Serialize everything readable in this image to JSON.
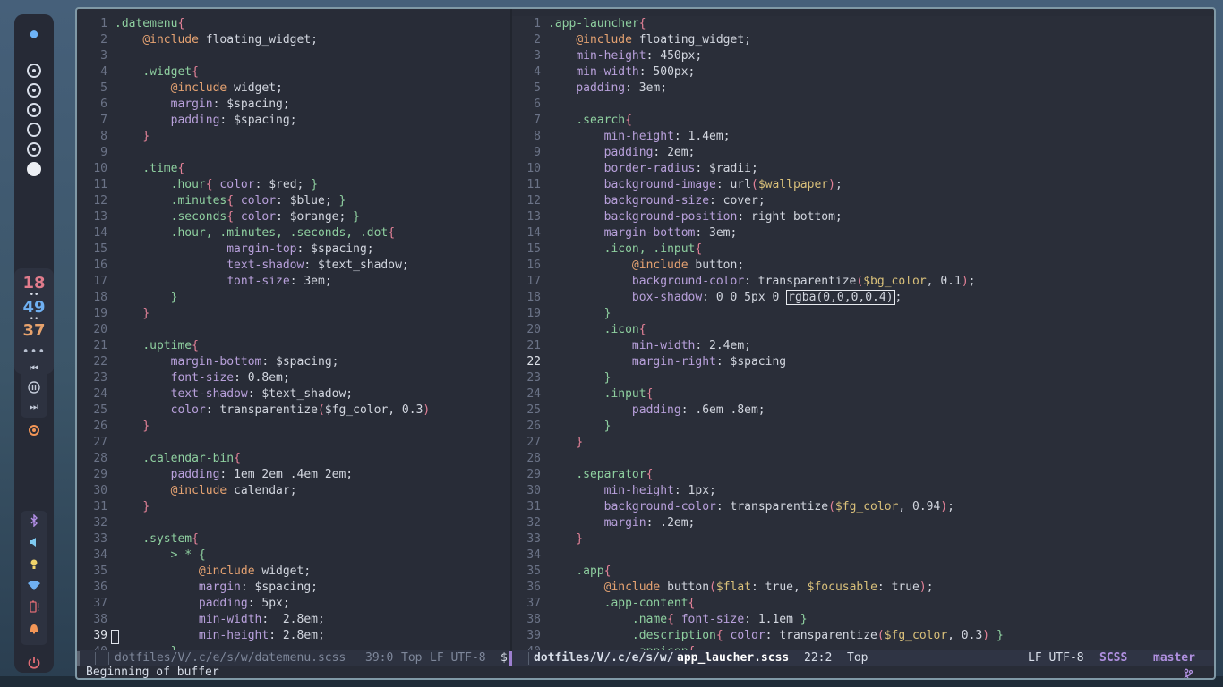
{
  "bar": {
    "logo_icon": "alien-icon",
    "workspaces": [
      "occupied",
      "occupied",
      "occupied",
      "empty",
      "occupied",
      "focused"
    ],
    "clock": {
      "hours": "18",
      "minutes": "49",
      "seconds": "37"
    },
    "media": {
      "prev_icon": "skip-previous-icon",
      "play_icon": "pause-icon",
      "next_icon": "skip-next-icon"
    },
    "system": [
      "bluetooth-icon",
      "volume-icon",
      "brightness-icon",
      "wifi-icon",
      "battery-icon",
      "notification-bell-icon"
    ],
    "power_icon": "power-icon"
  },
  "left_buffer": {
    "current_line": 39,
    "lines": [
      {
        "n": 1,
        "html": "<span class='sel'>.datemenu</span><span class='br'>{</span>"
      },
      {
        "n": 2,
        "html": "    <span class='inc'>@include</span> floating_widget;"
      },
      {
        "n": 3,
        "html": ""
      },
      {
        "n": 4,
        "html": "    <span class='sel'>.widget</span><span class='br'>{</span>"
      },
      {
        "n": 5,
        "html": "        <span class='inc'>@include</span> widget;"
      },
      {
        "n": 6,
        "html": "        <span class='prop'>margin</span>: $spacing;"
      },
      {
        "n": 7,
        "html": "        <span class='prop'>padding</span>: $spacing;"
      },
      {
        "n": 8,
        "html": "    <span class='br'>}</span>"
      },
      {
        "n": 9,
        "html": ""
      },
      {
        "n": 10,
        "html": "    <span class='sel'>.time</span><span class='br'>{</span>"
      },
      {
        "n": 11,
        "html": "        <span class='sel'>.hour</span><span class='br'>{</span> <span class='prop'>color</span>: $red; <span class='sel'>}</span>"
      },
      {
        "n": 12,
        "html": "        <span class='sel'>.minutes</span><span class='br'>{</span> <span class='prop'>color</span>: $blue; <span class='sel'>}</span>"
      },
      {
        "n": 13,
        "html": "        <span class='sel'>.seconds</span><span class='br'>{</span> <span class='prop'>color</span>: $orange; <span class='sel'>}</span>"
      },
      {
        "n": 14,
        "html": "        <span class='sel'>.hour, .minutes, .seconds, .dot</span><span class='br'>{</span>"
      },
      {
        "n": 15,
        "html": "                <span class='prop'>margin-top</span>: $spacing;"
      },
      {
        "n": 16,
        "html": "                <span class='prop'>text-shadow</span>: $text_shadow;"
      },
      {
        "n": 17,
        "html": "                <span class='prop'>font-size</span>: 3em;"
      },
      {
        "n": 18,
        "html": "        <span class='sel'>}</span>"
      },
      {
        "n": 19,
        "html": "    <span class='br'>}</span>"
      },
      {
        "n": 20,
        "html": ""
      },
      {
        "n": 21,
        "html": "    <span class='sel'>.uptime</span><span class='br'>{</span>"
      },
      {
        "n": 22,
        "html": "        <span class='prop'>margin-bottom</span>: $spacing;"
      },
      {
        "n": 23,
        "html": "        <span class='prop'>font-size</span>: 0.8em;"
      },
      {
        "n": 24,
        "html": "        <span class='prop'>text-shadow</span>: $text_shadow;"
      },
      {
        "n": 25,
        "html": "        <span class='prop'>color</span>: transparentize<span class='br'>(</span>$fg_color, 0.3<span class='br'>)</span>"
      },
      {
        "n": 26,
        "html": "    <span class='br'>}</span>"
      },
      {
        "n": 27,
        "html": ""
      },
      {
        "n": 28,
        "html": "    <span class='sel'>.calendar-bin</span><span class='br'>{</span>"
      },
      {
        "n": 29,
        "html": "        <span class='prop'>padding</span>: 1em 2em .4em 2em;"
      },
      {
        "n": 30,
        "html": "        <span class='inc'>@include</span> calendar;"
      },
      {
        "n": 31,
        "html": "    <span class='br'>}</span>"
      },
      {
        "n": 32,
        "html": ""
      },
      {
        "n": 33,
        "html": "    <span class='sel'>.system</span><span class='br'>{</span>"
      },
      {
        "n": 34,
        "html": "        <span class='sel'>&gt; * {</span>"
      },
      {
        "n": 35,
        "html": "            <span class='inc'>@include</span> widget;"
      },
      {
        "n": 36,
        "html": "            <span class='prop'>margin</span>: $spacing;"
      },
      {
        "n": 37,
        "html": "            <span class='prop'>padding</span>: 5px;"
      },
      {
        "n": 38,
        "html": "            <span class='prop'>min-width</span>:  2.8em;"
      },
      {
        "n": 39,
        "html": "            <span class='prop'>min-height</span>: 2.8em;"
      },
      {
        "n": 40,
        "html": "        <span class='sel'>}</span>"
      }
    ]
  },
  "right_buffer": {
    "current_line": 22,
    "lines": [
      {
        "n": 1,
        "html": "<span class='sel'>.app-launcher</span><span class='br'>{</span>"
      },
      {
        "n": 2,
        "html": "    <span class='inc'>@include</span> floating_widget;"
      },
      {
        "n": 3,
        "html": "    <span class='prop'>min-height</span>: 450px;"
      },
      {
        "n": 4,
        "html": "    <span class='prop'>min-width</span>: 500px;"
      },
      {
        "n": 5,
        "html": "    <span class='prop'>padding</span>: 3em;"
      },
      {
        "n": 6,
        "html": ""
      },
      {
        "n": 7,
        "html": "    <span class='sel'>.search</span><span class='br'>{</span>"
      },
      {
        "n": 8,
        "html": "        <span class='prop'>min-height</span>: 1.4em;"
      },
      {
        "n": 9,
        "html": "        <span class='prop'>padding</span>: 2em;"
      },
      {
        "n": 10,
        "html": "        <span class='prop'>border-radius</span>: $radii;"
      },
      {
        "n": 11,
        "html": "        <span class='prop'>background-image</span>: url<span class='br'>(</span><span class='var'>$wallpaper</span><span class='br'>)</span>;"
      },
      {
        "n": 12,
        "html": "        <span class='prop'>background-size</span>: cover;"
      },
      {
        "n": 13,
        "html": "        <span class='prop'>background-position</span>: right bottom;"
      },
      {
        "n": 14,
        "html": "        <span class='prop'>margin-bottom</span>: 3em;"
      },
      {
        "n": 15,
        "html": "        <span class='sel'>.icon, .input</span><span class='br'>{</span>"
      },
      {
        "n": 16,
        "html": "            <span class='inc'>@include</span> button;"
      },
      {
        "n": 17,
        "html": "            <span class='prop'>background-color</span>: transparentize<span class='br'>(</span><span class='var'>$bg_color</span>, 0.1<span class='br'>)</span>;"
      },
      {
        "n": 18,
        "html": "            <span class='prop'>box-shadow</span>: 0 0 5px 0 <span class='hl'>rgba(0,0,0,0.4)</span>;"
      },
      {
        "n": 19,
        "html": "        <span class='sel'>}</span>"
      },
      {
        "n": 20,
        "html": "        <span class='sel'>.icon</span><span class='br'>{</span>"
      },
      {
        "n": 21,
        "html": "            <span class='prop'>min-width</span>: 2.4em;"
      },
      {
        "n": 22,
        "html": "            <span class='prop'>margin-right</span>: $spacing"
      },
      {
        "n": 23,
        "html": "        <span class='sel'>}</span>"
      },
      {
        "n": 24,
        "html": "        <span class='sel'>.input</span><span class='br'>{</span>"
      },
      {
        "n": 25,
        "html": "            <span class='prop'>padding</span>: .6em .8em;"
      },
      {
        "n": 26,
        "html": "        <span class='sel'>}</span>"
      },
      {
        "n": 27,
        "html": "    <span class='br'>}</span>"
      },
      {
        "n": 28,
        "html": ""
      },
      {
        "n": 29,
        "html": "    <span class='sel'>.separator</span><span class='br'>{</span>"
      },
      {
        "n": 30,
        "html": "        <span class='prop'>min-height</span>: 1px;"
      },
      {
        "n": 31,
        "html": "        <span class='prop'>background-color</span>: transparentize<span class='br'>(</span><span class='var'>$fg_color</span>, 0.94<span class='br'>)</span>;"
      },
      {
        "n": 32,
        "html": "        <span class='prop'>margin</span>: .2em;"
      },
      {
        "n": 33,
        "html": "    <span class='br'>}</span>"
      },
      {
        "n": 34,
        "html": ""
      },
      {
        "n": 35,
        "html": "    <span class='sel'>.app</span><span class='br'>{</span>"
      },
      {
        "n": 36,
        "html": "        <span class='inc'>@include</span> button<span class='br'>(</span><span class='var'>$flat</span>: true, <span class='var'>$focusable</span>: true<span class='br'>)</span>;"
      },
      {
        "n": 37,
        "html": "        <span class='sel'>.app-content</span><span class='br'>{</span>"
      },
      {
        "n": 38,
        "html": "            <span class='sel'>.name</span><span class='br'>{</span> <span class='prop'>font-size</span>: 1.1em <span class='sel'>}</span>"
      },
      {
        "n": 39,
        "html": "            <span class='sel'>.description</span><span class='br'>{</span> <span class='prop'>color</span>: transparentize<span class='br'>(</span><span class='var'>$fg_color</span>, 0.3<span class='br'>)</span> <span class='sel'>}</span>"
      },
      {
        "n": 40,
        "html": "            <span class='sel'>.appicon</span><span class='br'>{</span>"
      }
    ]
  },
  "modeline_left": {
    "path": "dotfiles/V/.c/e/s/w/datemenu.scss",
    "position": "39:0",
    "scroll": "Top",
    "encoding": "LF UTF-8",
    "extra": "$"
  },
  "modeline_right": {
    "path_prefix": "dotfiles/V/.c/e/s/w/",
    "filename": "app_laucher.scss",
    "position": "22:2",
    "scroll": "Top",
    "encoding": "LF UTF-8",
    "mode": "SCSS",
    "branch": "master"
  },
  "echo_area": "Beginning of buffer"
}
